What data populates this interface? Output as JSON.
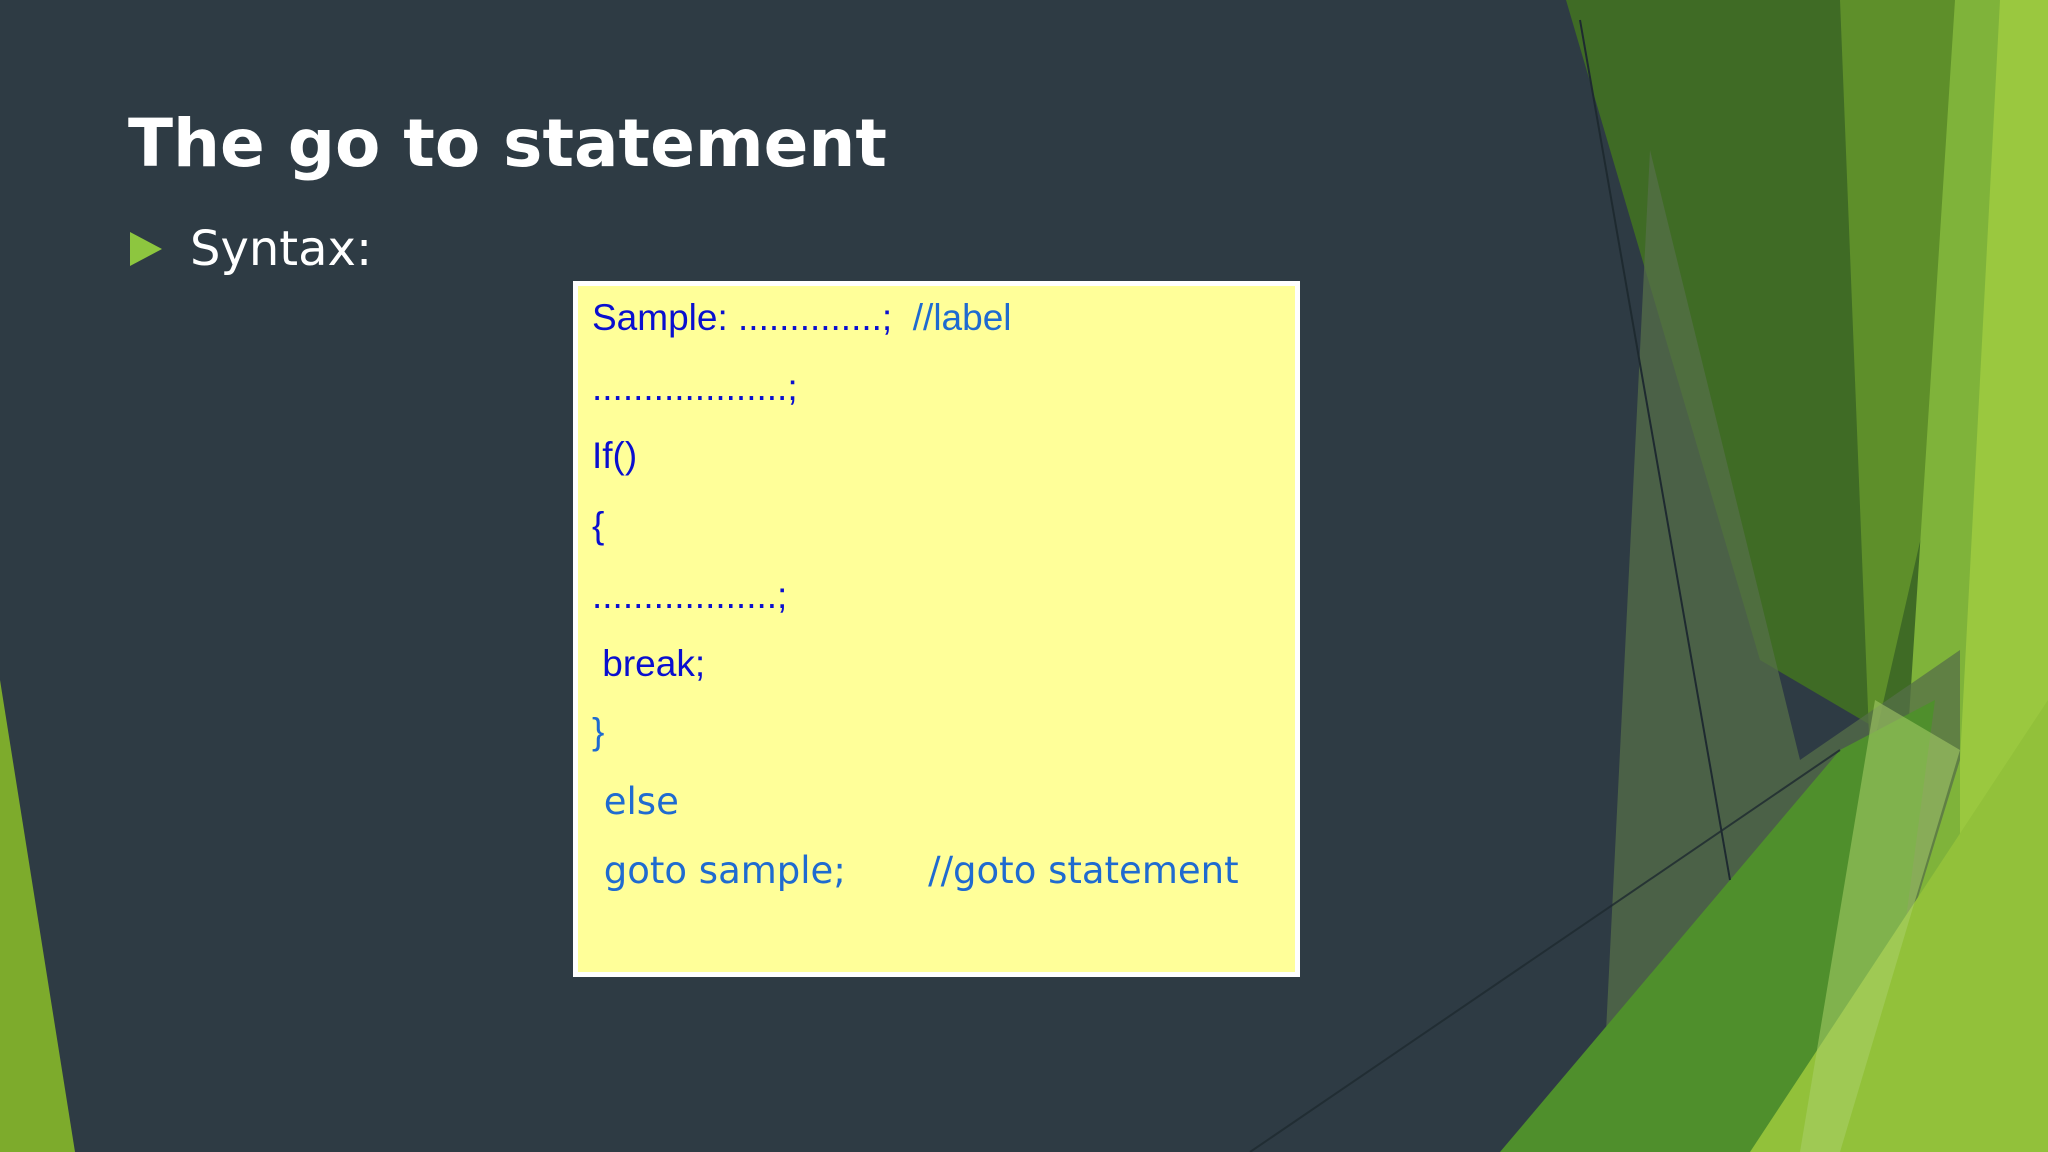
{
  "slide": {
    "title": "The go to statement",
    "bullet": {
      "icon": "triangle-bullet-icon",
      "text": "Syntax:"
    },
    "code_box": {
      "background": "#ffff99",
      "lines": [
        {
          "main": "Sample: ..............;",
          "comment": "//label"
        },
        {
          "main": "...................;"
        },
        {
          "main": "If()"
        },
        {
          "main": "{"
        },
        {
          "main": "..................;"
        },
        {
          "main": " break;"
        },
        {
          "main": "}"
        },
        {
          "main": " else"
        },
        {
          "main": " goto sample;",
          "comment": "//goto statement"
        }
      ]
    }
  },
  "colors": {
    "background": "#2e3b44",
    "accent_green": "#8dc63f",
    "code_dark_blue": "#0a0fcf",
    "code_light_blue": "#1f6bd0"
  }
}
